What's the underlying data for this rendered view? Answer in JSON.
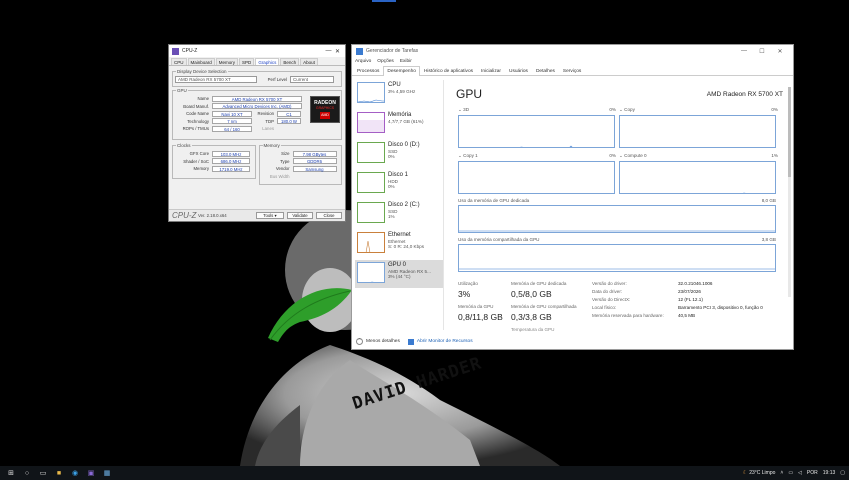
{
  "colors": {
    "accent": "#3b7bd0",
    "graph_border": "#7ca5d8",
    "taskbar": "#101418",
    "wallpaper_leaf": "#2e9e2a"
  },
  "wallpaper": {
    "tattoo_text": "DAVID HARDER"
  },
  "cpuz": {
    "title": "CPU-Z",
    "window_buttons": [
      "—",
      "✕"
    ],
    "tabs": [
      "CPU",
      "Mainboard",
      "Memory",
      "SPD",
      "Graphics",
      "Bench",
      "About"
    ],
    "active_tab": "Graphics",
    "display_selection_label": "Display Device Selection",
    "device_select": "AMD Radeon RX 5700 XT",
    "perf_level_label": "Perf Level",
    "perf_level_value": "Current",
    "gpu_group": "GPU",
    "name_label": "Name",
    "name_value": "AMD Radeon RX 5700 XT",
    "board_label": "Board Manuf.",
    "board_value": "Advanced Micro Devices Inc. (AMD)",
    "code_label": "Code Name",
    "code_value": "Navi 10 XT",
    "revision_label": "Revision",
    "revision_value": "C1",
    "tech_label": "Technology",
    "tech_value": "7 nm",
    "tdp_label": "TDP",
    "tdp_value": "180.0 W",
    "rops_label": "ROPs / TMUs",
    "rops_value": "64 / 160",
    "lanes_label": "Lanes",
    "logo_line1": "RADEON",
    "logo_line2": "GRAPHICS",
    "logo_line3": "AMD",
    "clocks_group": "Clocks",
    "gfx_label": "GFX Core",
    "gfx_value": "103.0 MHz",
    "shader_label": "Shader / SoC",
    "shader_value": "686.0 MHz",
    "mem_clk_label": "Memory",
    "mem_clk_value": "1719.0 MHz",
    "memory_group": "Memory",
    "size_label": "Size",
    "size_value": "7.98 GBytes",
    "type_label": "Type",
    "type_value": "GDDR6",
    "vendor_label": "Vendor",
    "vendor_value": "Samsung",
    "bus_label": "Bus Width",
    "footer_brand": "CPU-Z",
    "footer_version": "Ver. 2.18.0.x64",
    "tools_label": "Tools",
    "validate_label": "Validate",
    "close_label": "Close"
  },
  "taskmgr": {
    "title": "Gerenciador de Tarefas",
    "window_buttons": [
      "—",
      "☐",
      "✕"
    ],
    "menu": [
      "Arquivo",
      "Opções",
      "Exibir"
    ],
    "tabs": [
      "Processos",
      "Desempenho",
      "Histórico de aplicativos",
      "Inicializar",
      "Usuários",
      "Detalhes",
      "Serviços"
    ],
    "active_tab": "Desempenho",
    "resources": [
      {
        "name": "CPU",
        "s1": "3% 4,59 GHz",
        "s2": ""
      },
      {
        "name": "Memória",
        "s1": "4,7/7,7 GB (61%)",
        "s2": ""
      },
      {
        "name": "Disco 0 (D:)",
        "s1": "SSD",
        "s2": "0%"
      },
      {
        "name": "Disco 1",
        "s1": "HDD",
        "s2": "0%"
      },
      {
        "name": "Disco 2 (C:)",
        "s1": "SSD",
        "s2": "1%"
      },
      {
        "name": "Ethernet",
        "s1": "Ethernet",
        "s2": "S: 0  R: 24,0 Kbps"
      },
      {
        "name": "GPU 0",
        "s1": "AMD Radeon RX 5...",
        "s2": "3% (44 °C)"
      }
    ],
    "gpu": {
      "title": "GPU",
      "model": "AMD Radeon RX 5700 XT",
      "graphs": [
        {
          "label": "3D",
          "pct": "0%"
        },
        {
          "label": "Copy",
          "pct": "0%"
        },
        {
          "label": "Copy 1",
          "pct": "0%"
        },
        {
          "label": "Compute 0",
          "pct": "1%"
        }
      ],
      "dedicated_label": "Uso da memória de GPU dedicada",
      "dedicated_max": "8,0 GB",
      "shared_label": "Uso da memória compartilhada da GPU",
      "shared_max": "3,8 GB",
      "stats": {
        "util_label": "Utilização",
        "util_value": "3%",
        "ded_label": "Memória de GPU dedicada",
        "ded_value": "0,5/8,0 GB",
        "gpumem_label": "Memória da GPU",
        "gpumem_value": "0,8/11,8 GB",
        "shared_label": "Memória de GPU compartilhada",
        "shared_value": "0,3/3,8 GB",
        "temp_label": "Temperatura da GPU"
      },
      "details": [
        {
          "k": "Versão do driver:",
          "v": "32.0.21046.1006"
        },
        {
          "k": "Data do driver:",
          "v": "23/07/2026"
        },
        {
          "k": "Versão do DirectX:",
          "v": "12 (FL 12.1)"
        },
        {
          "k": "Local físico:",
          "v": "Barramento PCI 3, dispositivo 0, função 0"
        },
        {
          "k": "Memória reservada para hardware:",
          "v": "40,5 MB"
        }
      ]
    },
    "footer_less": "Menos detalhes",
    "footer_monitor": "Abrir Monitor de Recursos"
  },
  "taskbar": {
    "weather": "23°C  Limpo",
    "lang": "POR",
    "time": "19:13"
  }
}
